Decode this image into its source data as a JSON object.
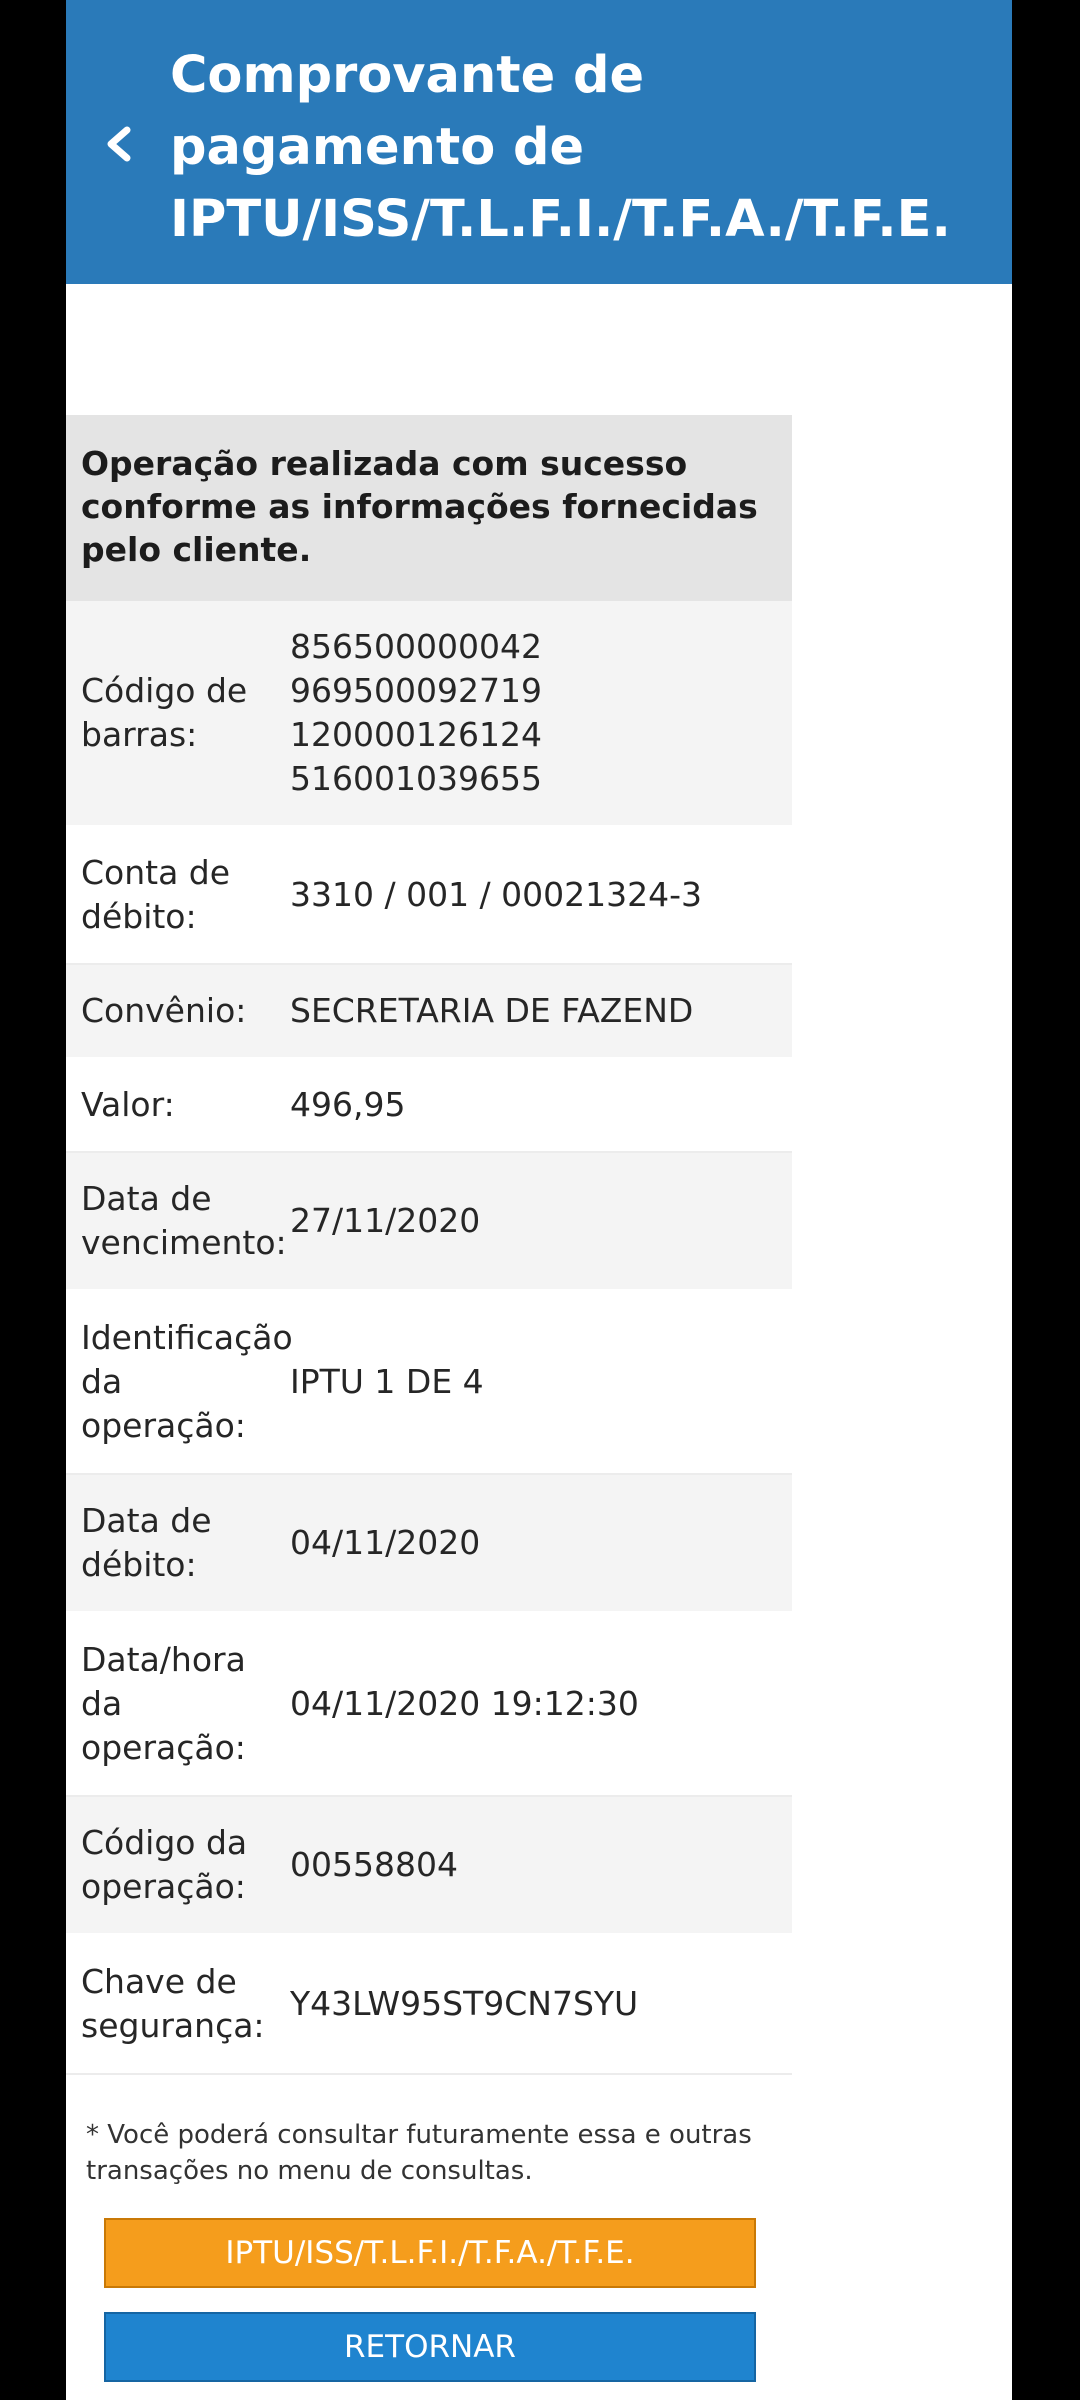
{
  "header": {
    "title": "Comprovante de\npagamento de\nIPTU/ISS/T.L.F.I./T.F.A./T.F.E.",
    "back_icon": "chevron-left-icon"
  },
  "receipt": {
    "heading": "Operação realizada com sucesso conforme as informações fornecidas pelo cliente.",
    "rows": [
      {
        "label": "Código de\nbarras:",
        "value": "856500000042\n969500092719\n120000126124\n516001039655"
      },
      {
        "label": "Conta de\ndébito:",
        "value": "3310 / 001 / 00021324-3"
      },
      {
        "label": "Convênio:",
        "value": "SECRETARIA DE FAZEND"
      },
      {
        "label": "Valor:",
        "value": "496,95"
      },
      {
        "label": "Data de\nvencimento:",
        "value": "27/11/2020"
      },
      {
        "label": "Identificação\nda\noperação:",
        "value": "IPTU 1 DE 4"
      },
      {
        "label": "Data de\ndébito:",
        "value": "04/11/2020"
      },
      {
        "label": "Data/hora\nda\noperação:",
        "value": "04/11/2020 19:12:30"
      },
      {
        "label": "Código da\noperação:",
        "value": "00558804"
      },
      {
        "label": "Chave de\nsegurança:",
        "value": "Y43LW95ST9CN7SYU"
      }
    ]
  },
  "note": "* Você poderá consultar futuramente essa e outras transações no menu de consultas.",
  "buttons": {
    "primary_label": "IPTU/ISS/T.L.F.I./T.F.A./T.F.E.",
    "return_label": "RETORNAR"
  },
  "colors": {
    "header_bg": "#2a7ab9",
    "orange_button": "#f59d1c",
    "blue_button": "#1f84cf",
    "row_shade": "#f4f4f4",
    "heading_bg": "#e4e4e4"
  }
}
